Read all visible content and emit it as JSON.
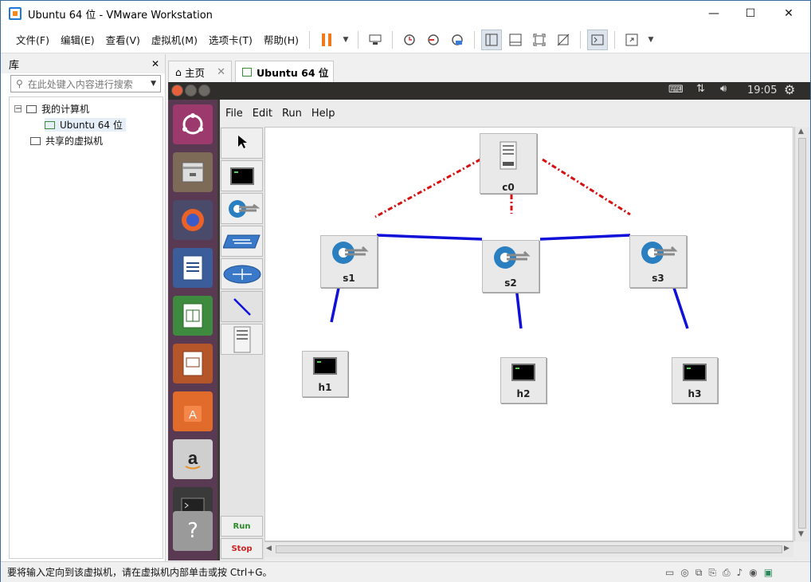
{
  "window": {
    "title": "Ubuntu 64 位 - VMware Workstation",
    "min": "—",
    "max": "☐",
    "close": "✕"
  },
  "menu": [
    "文件(F)",
    "编辑(E)",
    "查看(V)",
    "虚拟机(M)",
    "选项卡(T)",
    "帮助(H)"
  ],
  "library": {
    "title": "库",
    "close": "✕",
    "search_placeholder": "在此处键入内容进行搜索",
    "tree": [
      {
        "label": "我的计算机",
        "level": 0,
        "expanded": true
      },
      {
        "label": "Ubuntu 64 位",
        "level": 1,
        "selected": true
      },
      {
        "label": "共享的虚拟机",
        "level": 0
      }
    ]
  },
  "tabs": [
    {
      "label": "主页",
      "active": false
    },
    {
      "label": "Ubuntu 64 位",
      "active": true
    }
  ],
  "vm": {
    "topbar": {
      "time": "19:05"
    },
    "miniedit": {
      "menu": [
        "File",
        "Edit",
        "Run",
        "Help"
      ],
      "run_label": "Run",
      "stop_label": "Stop",
      "nodes": {
        "c0": "c0",
        "s1": "s1",
        "s2": "s2",
        "s3": "s3",
        "h1": "h1",
        "h2": "h2",
        "h3": "h3"
      }
    }
  },
  "status": {
    "message": "要将输入定向到该虚拟机，请在虚拟机内部单击或按 Ctrl+G。"
  },
  "colors": {
    "link": "#1010d8",
    "controller_link": "#d81010",
    "ubuntu_launcher": "#5a3a52"
  }
}
